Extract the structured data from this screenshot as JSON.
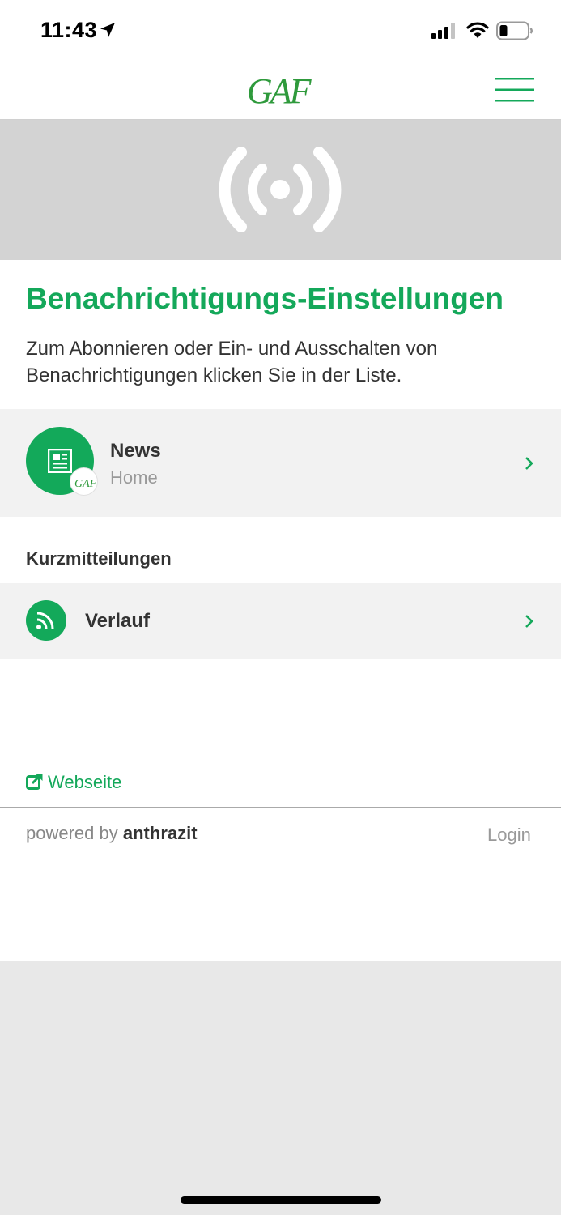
{
  "status_bar": {
    "time": "11:43",
    "icons": [
      "location-arrow-icon",
      "cellular-signal-icon",
      "wifi-icon",
      "battery-icon"
    ]
  },
  "header": {
    "logo_text": "GAF",
    "menu_icon": "hamburger-menu-icon"
  },
  "hero": {
    "icon": "broadcast-icon"
  },
  "page": {
    "title": "Benachrichtigungs-Einstellungen",
    "description": "Zum Abonnieren oder Ein- und Ausschalten von Benachrichtigungen klicken Sie in der Liste."
  },
  "news_item": {
    "title": "News",
    "subtitle": "Home",
    "icon": "newspaper-icon",
    "badge_text": "GAF"
  },
  "section": {
    "heading": "Kurzmitteilungen"
  },
  "verlauf_item": {
    "title": "Verlauf",
    "icon": "rss-feed-icon"
  },
  "footer": {
    "website_link": "Webseite",
    "powered_prefix": "powered by",
    "powered_brand": "anthrazit",
    "login": "Login"
  },
  "colors": {
    "accent": "#14a85a",
    "hero_bg": "#d3d3d3",
    "row_bg": "#f2f2f2",
    "page_bottom": "#e8e8e8"
  }
}
